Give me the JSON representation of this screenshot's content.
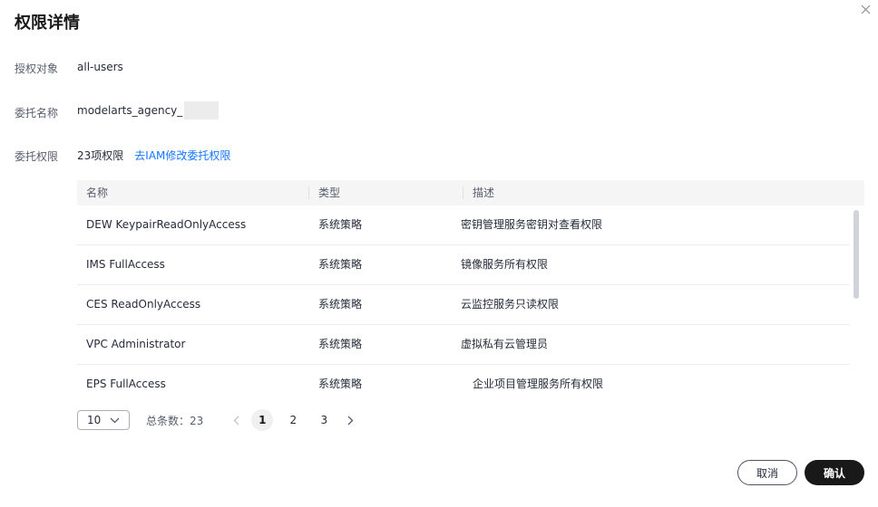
{
  "dialog": {
    "title": "权限详情",
    "close_icon": "close-icon"
  },
  "fields": {
    "grantee_label": "授权对象",
    "grantee_value": "all-users",
    "agency_label": "委托名称",
    "agency_value": "modelarts_agency_",
    "permission_label": "委托权限",
    "permission_count": "23项权限",
    "permission_link": "去IAM修改委托权限"
  },
  "table": {
    "headers": [
      "名称",
      "类型",
      "描述"
    ],
    "rows": [
      {
        "name": "DEW KeypairReadOnlyAccess",
        "type": "系统策略",
        "desc": "密钥管理服务密钥对查看权限"
      },
      {
        "name": "IMS FullAccess",
        "type": "系统策略",
        "desc": "镜像服务所有权限"
      },
      {
        "name": "CES ReadOnlyAccess",
        "type": "系统策略",
        "desc": "云监控服务只读权限"
      },
      {
        "name": "VPC Administrator",
        "type": "系统策略",
        "desc": "虚拟私有云管理员"
      },
      {
        "name": "EPS FullAccess",
        "type": "系统策略",
        "desc": "企业项目管理服务所有权限"
      }
    ]
  },
  "pagination": {
    "page_size": "10",
    "total": "总条数：23",
    "pages": [
      "1",
      "2",
      "3"
    ],
    "current_page": "1"
  },
  "footer": {
    "cancel_label": "取消",
    "confirm_label": "确认"
  }
}
